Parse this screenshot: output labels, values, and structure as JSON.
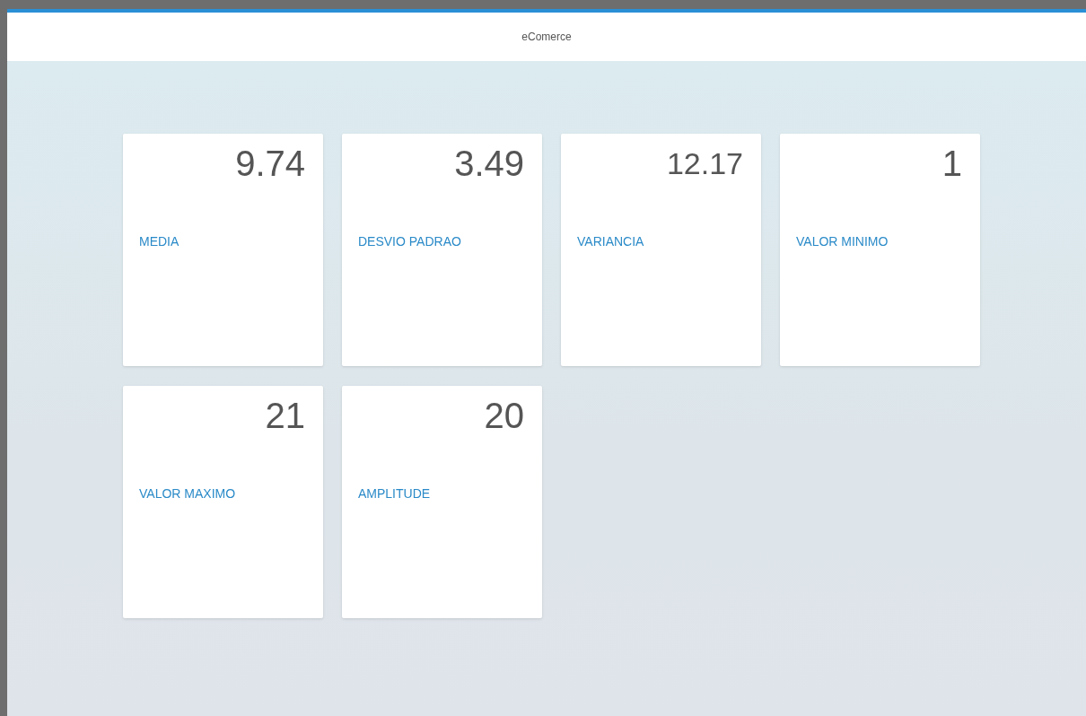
{
  "header": {
    "title": "eComerce"
  },
  "tiles": [
    {
      "value": "9.74",
      "label": "MEDIA"
    },
    {
      "value": "3.49",
      "label": "DESVIO PADRAO"
    },
    {
      "value": "12.17",
      "label": "VARIANCIA"
    },
    {
      "value": "1",
      "label": "VALOR MINIMO"
    },
    {
      "value": "21",
      "label": "VALOR MAXIMO"
    },
    {
      "value": "20",
      "label": "AMPLITUDE"
    }
  ]
}
